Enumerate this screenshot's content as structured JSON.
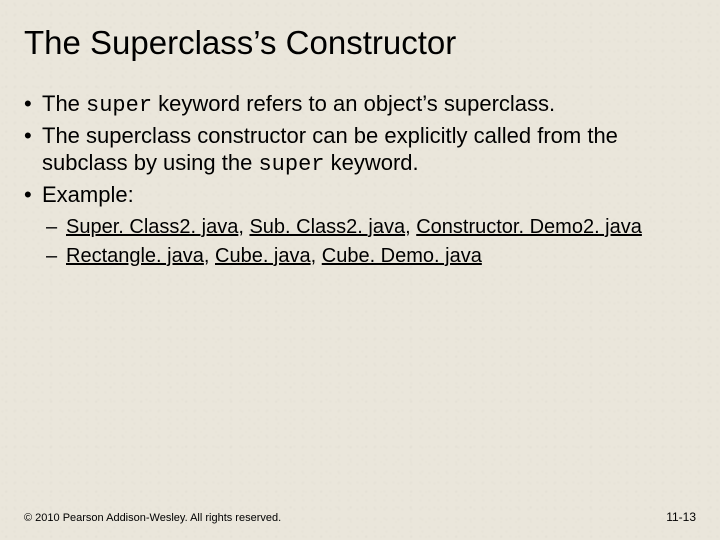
{
  "title": "The Superclass’s Constructor",
  "bullets": [
    {
      "pre": "The ",
      "keyword": "super",
      "post": " keyword refers to an object’s superclass."
    },
    {
      "pre": "The superclass constructor can be explicitly called from the subclass by using the ",
      "keyword": "super",
      "post": " keyword."
    },
    {
      "pre": "Example:",
      "keyword": "",
      "post": ""
    }
  ],
  "sub": [
    {
      "links": [
        "Super. Class2. java",
        "Sub. Class2. java",
        "Constructor. Demo2. java"
      ]
    },
    {
      "links": [
        "Rectangle. java",
        "Cube. java",
        "Cube. Demo. java"
      ]
    }
  ],
  "footer": {
    "copyright": "© 2010 Pearson Addison-Wesley. All rights reserved.",
    "page": "11-13"
  },
  "sep": ", "
}
